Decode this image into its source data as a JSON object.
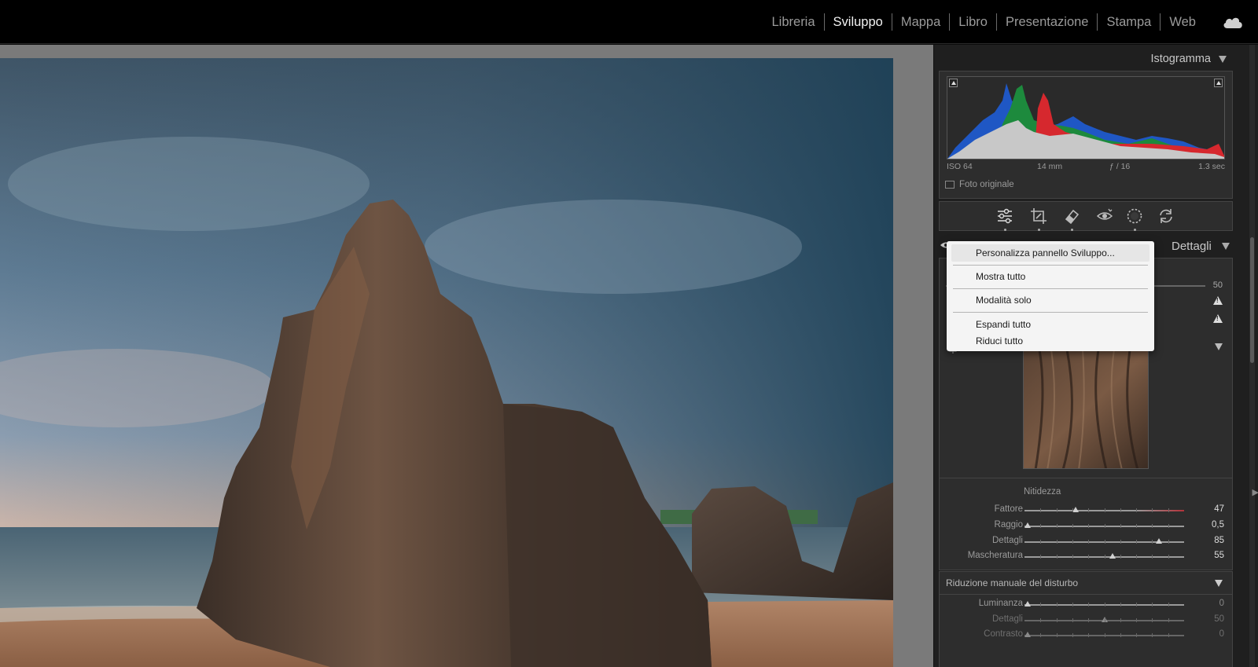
{
  "topbar": {
    "modules": [
      "Libreria",
      "Sviluppo",
      "Mappa",
      "Libro",
      "Presentazione",
      "Stampa",
      "Web"
    ],
    "active_module": "Sviluppo",
    "cloud_icon": "cloud-icon"
  },
  "histogram": {
    "title": "Istogramma",
    "exif": {
      "iso": "ISO 64",
      "focal": "14 mm",
      "aperture": "ƒ / 16",
      "shutter": "1.3 sec"
    },
    "original_photo_label": "Foto originale"
  },
  "tools": [
    "sliders-icon",
    "crop-icon",
    "eraser-icon",
    "red-eye-icon",
    "masking-icon",
    "reset-icon"
  ],
  "details_panel": {
    "title": "Dettagli",
    "scale_value": "50",
    "sharpening": {
      "title": "Nitidezza",
      "sliders": [
        {
          "label": "Fattore",
          "value": "47",
          "position": 0.32
        },
        {
          "label": "Raggio",
          "value": "0,5",
          "position": 0.02
        },
        {
          "label": "Dettagli",
          "value": "85",
          "position": 0.84
        },
        {
          "label": "Mascheratura",
          "value": "55",
          "position": 0.55
        }
      ]
    },
    "noise_reduction": {
      "title": "Riduzione manuale del disturbo",
      "sliders": [
        {
          "label": "Luminanza",
          "value": "0",
          "position": 0.02
        },
        {
          "label": "Dettagli",
          "value": "50",
          "position": 0.5
        },
        {
          "label": "Contrasto",
          "value": "0",
          "position": 0.02
        }
      ]
    }
  },
  "context_menu": {
    "items": [
      "Personalizza pannello Sviluppo...",
      "Mostra tutto",
      "Modalità solo",
      "Espandi tutto",
      "Riduci tutto"
    ]
  }
}
